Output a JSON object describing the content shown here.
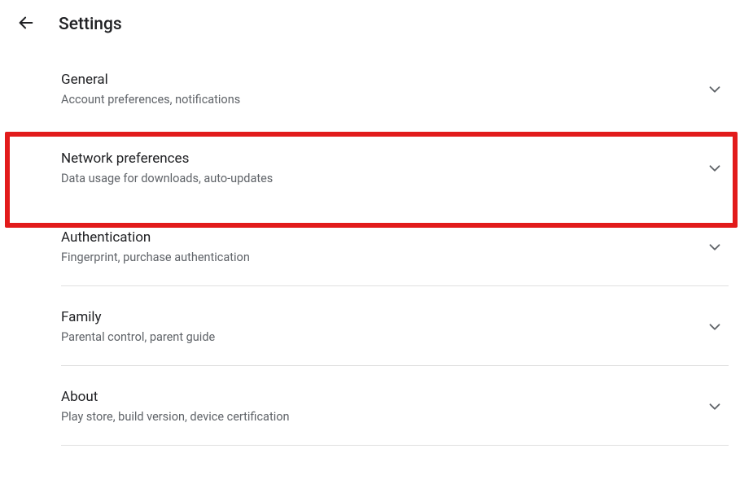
{
  "header": {
    "title": "Settings"
  },
  "items": [
    {
      "title": "General",
      "subtitle": "Account preferences, notifications",
      "divider": false,
      "highlighted": false
    },
    {
      "title": "Network preferences",
      "subtitle": "Data usage for downloads, auto-updates",
      "divider": false,
      "highlighted": true
    },
    {
      "title": "Authentication",
      "subtitle": "Fingerprint, purchase authentication",
      "divider": true,
      "highlighted": false
    },
    {
      "title": "Family",
      "subtitle": "Parental control, parent guide",
      "divider": true,
      "highlighted": false
    },
    {
      "title": "About",
      "subtitle": "Play store, build version, device certification",
      "divider": true,
      "highlighted": false
    }
  ]
}
